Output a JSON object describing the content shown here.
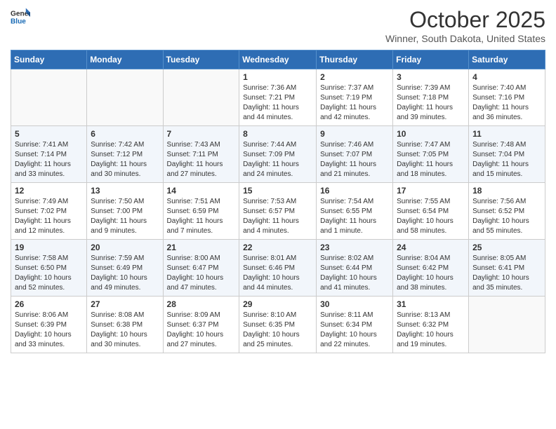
{
  "header": {
    "logo_general": "General",
    "logo_blue": "Blue",
    "month": "October 2025",
    "location": "Winner, South Dakota, United States"
  },
  "days_of_week": [
    "Sunday",
    "Monday",
    "Tuesday",
    "Wednesday",
    "Thursday",
    "Friday",
    "Saturday"
  ],
  "weeks": [
    [
      {
        "day": "",
        "detail": ""
      },
      {
        "day": "",
        "detail": ""
      },
      {
        "day": "",
        "detail": ""
      },
      {
        "day": "1",
        "detail": "Sunrise: 7:36 AM\nSunset: 7:21 PM\nDaylight: 11 hours\nand 44 minutes."
      },
      {
        "day": "2",
        "detail": "Sunrise: 7:37 AM\nSunset: 7:19 PM\nDaylight: 11 hours\nand 42 minutes."
      },
      {
        "day": "3",
        "detail": "Sunrise: 7:39 AM\nSunset: 7:18 PM\nDaylight: 11 hours\nand 39 minutes."
      },
      {
        "day": "4",
        "detail": "Sunrise: 7:40 AM\nSunset: 7:16 PM\nDaylight: 11 hours\nand 36 minutes."
      }
    ],
    [
      {
        "day": "5",
        "detail": "Sunrise: 7:41 AM\nSunset: 7:14 PM\nDaylight: 11 hours\nand 33 minutes."
      },
      {
        "day": "6",
        "detail": "Sunrise: 7:42 AM\nSunset: 7:12 PM\nDaylight: 11 hours\nand 30 minutes."
      },
      {
        "day": "7",
        "detail": "Sunrise: 7:43 AM\nSunset: 7:11 PM\nDaylight: 11 hours\nand 27 minutes."
      },
      {
        "day": "8",
        "detail": "Sunrise: 7:44 AM\nSunset: 7:09 PM\nDaylight: 11 hours\nand 24 minutes."
      },
      {
        "day": "9",
        "detail": "Sunrise: 7:46 AM\nSunset: 7:07 PM\nDaylight: 11 hours\nand 21 minutes."
      },
      {
        "day": "10",
        "detail": "Sunrise: 7:47 AM\nSunset: 7:05 PM\nDaylight: 11 hours\nand 18 minutes."
      },
      {
        "day": "11",
        "detail": "Sunrise: 7:48 AM\nSunset: 7:04 PM\nDaylight: 11 hours\nand 15 minutes."
      }
    ],
    [
      {
        "day": "12",
        "detail": "Sunrise: 7:49 AM\nSunset: 7:02 PM\nDaylight: 11 hours\nand 12 minutes."
      },
      {
        "day": "13",
        "detail": "Sunrise: 7:50 AM\nSunset: 7:00 PM\nDaylight: 11 hours\nand 9 minutes."
      },
      {
        "day": "14",
        "detail": "Sunrise: 7:51 AM\nSunset: 6:59 PM\nDaylight: 11 hours\nand 7 minutes."
      },
      {
        "day": "15",
        "detail": "Sunrise: 7:53 AM\nSunset: 6:57 PM\nDaylight: 11 hours\nand 4 minutes."
      },
      {
        "day": "16",
        "detail": "Sunrise: 7:54 AM\nSunset: 6:55 PM\nDaylight: 11 hours\nand 1 minute."
      },
      {
        "day": "17",
        "detail": "Sunrise: 7:55 AM\nSunset: 6:54 PM\nDaylight: 10 hours\nand 58 minutes."
      },
      {
        "day": "18",
        "detail": "Sunrise: 7:56 AM\nSunset: 6:52 PM\nDaylight: 10 hours\nand 55 minutes."
      }
    ],
    [
      {
        "day": "19",
        "detail": "Sunrise: 7:58 AM\nSunset: 6:50 PM\nDaylight: 10 hours\nand 52 minutes."
      },
      {
        "day": "20",
        "detail": "Sunrise: 7:59 AM\nSunset: 6:49 PM\nDaylight: 10 hours\nand 49 minutes."
      },
      {
        "day": "21",
        "detail": "Sunrise: 8:00 AM\nSunset: 6:47 PM\nDaylight: 10 hours\nand 47 minutes."
      },
      {
        "day": "22",
        "detail": "Sunrise: 8:01 AM\nSunset: 6:46 PM\nDaylight: 10 hours\nand 44 minutes."
      },
      {
        "day": "23",
        "detail": "Sunrise: 8:02 AM\nSunset: 6:44 PM\nDaylight: 10 hours\nand 41 minutes."
      },
      {
        "day": "24",
        "detail": "Sunrise: 8:04 AM\nSunset: 6:42 PM\nDaylight: 10 hours\nand 38 minutes."
      },
      {
        "day": "25",
        "detail": "Sunrise: 8:05 AM\nSunset: 6:41 PM\nDaylight: 10 hours\nand 35 minutes."
      }
    ],
    [
      {
        "day": "26",
        "detail": "Sunrise: 8:06 AM\nSunset: 6:39 PM\nDaylight: 10 hours\nand 33 minutes."
      },
      {
        "day": "27",
        "detail": "Sunrise: 8:08 AM\nSunset: 6:38 PM\nDaylight: 10 hours\nand 30 minutes."
      },
      {
        "day": "28",
        "detail": "Sunrise: 8:09 AM\nSunset: 6:37 PM\nDaylight: 10 hours\nand 27 minutes."
      },
      {
        "day": "29",
        "detail": "Sunrise: 8:10 AM\nSunset: 6:35 PM\nDaylight: 10 hours\nand 25 minutes."
      },
      {
        "day": "30",
        "detail": "Sunrise: 8:11 AM\nSunset: 6:34 PM\nDaylight: 10 hours\nand 22 minutes."
      },
      {
        "day": "31",
        "detail": "Sunrise: 8:13 AM\nSunset: 6:32 PM\nDaylight: 10 hours\nand 19 minutes."
      },
      {
        "day": "",
        "detail": ""
      }
    ]
  ]
}
